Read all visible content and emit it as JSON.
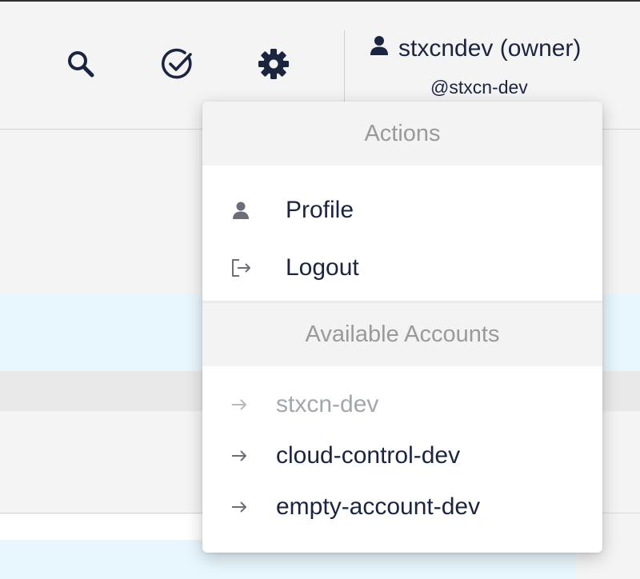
{
  "header": {
    "icons": {
      "search": "search-icon",
      "tasks": "check-circle-icon",
      "settings": "gear-icon",
      "user": "user-icon"
    },
    "user": {
      "name": "stxcndev (owner)",
      "handle": "@stxcn-dev"
    }
  },
  "menu": {
    "actions_title": "Actions",
    "actions": [
      {
        "label": "Profile",
        "icon": "user-icon"
      },
      {
        "label": "Logout",
        "icon": "logout-icon"
      }
    ],
    "accounts_title": "Available Accounts",
    "accounts": [
      {
        "label": "stxcn-dev",
        "icon": "arrow-right-icon",
        "current": true
      },
      {
        "label": "cloud-control-dev",
        "icon": "arrow-right-icon",
        "current": false
      },
      {
        "label": "empty-account-dev",
        "icon": "arrow-right-icon",
        "current": false
      }
    ]
  },
  "colors": {
    "text_dark": "#1b2540",
    "muted": "#9a9a9a",
    "disabled": "#a3a6ad",
    "highlight_row": "#e8f6fd",
    "header_bg": "#f4f4f4"
  }
}
